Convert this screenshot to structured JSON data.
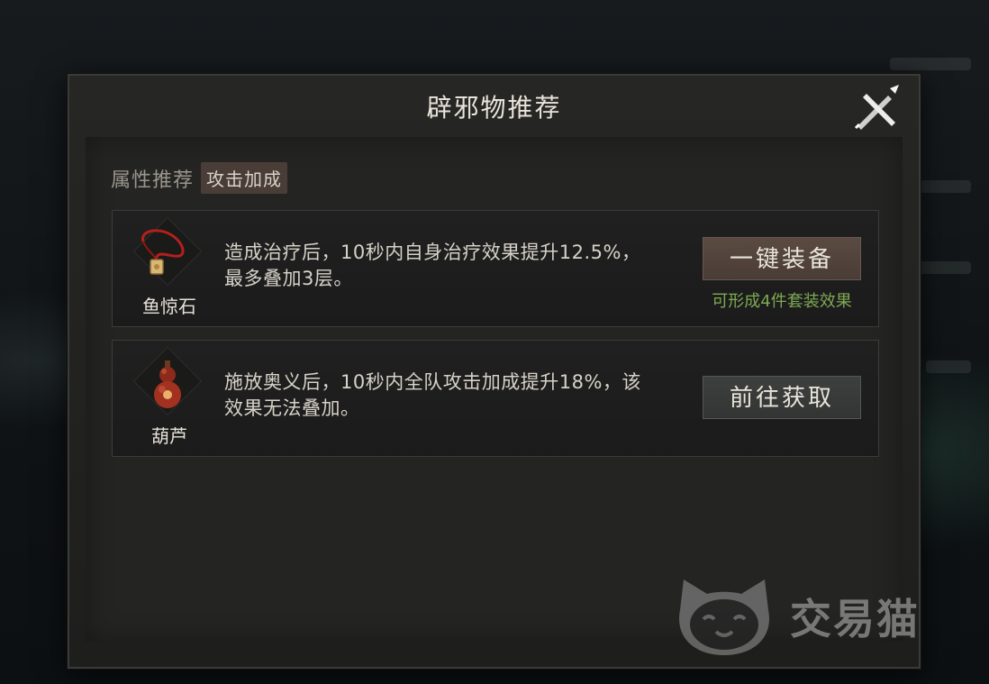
{
  "dialog": {
    "title": "辟邪物推荐"
  },
  "attribute": {
    "label": "属性推荐",
    "tag": "攻击加成"
  },
  "items": [
    {
      "name": "鱼惊石",
      "description": "造成治疗后，10秒内自身治疗效果提升12.5%，最多叠加3层。",
      "action_label": "一键装备",
      "hint": "可形成4件套装效果",
      "icon": "pendant-icon"
    },
    {
      "name": "葫芦",
      "description": "施放奥义后，10秒内全队攻击加成提升18%，该效果无法叠加。",
      "action_label": "前往获取",
      "icon": "gourd-icon"
    }
  ],
  "watermark": {
    "text": "交易猫",
    "icon": "cat-logo-icon"
  },
  "colors": {
    "equip_button": "#4a3c36",
    "obtain_button": "#333534",
    "hint_green": "#7ea952",
    "attr_tag_bg": "#4a3d38"
  }
}
